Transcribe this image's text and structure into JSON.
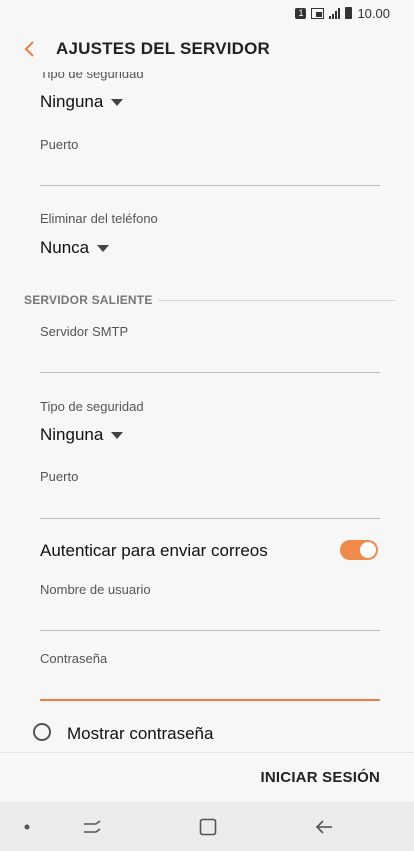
{
  "status_bar": {
    "sim": "1",
    "time": "10.00"
  },
  "header": {
    "title": "AJUSTES DEL SERVIDOR"
  },
  "incoming": {
    "security_type_label": "Tipo de seguridad",
    "security_type_value": "Ninguna",
    "port_label": "Puerto",
    "port_value": "",
    "delete_label": "Eliminar del teléfono",
    "delete_value": "Nunca"
  },
  "outgoing": {
    "section_title": "SERVIDOR SALIENTE",
    "smtp_label": "Servidor SMTP",
    "smtp_value": "",
    "security_type_label": "Tipo de seguridad",
    "security_type_value": "Ninguna",
    "port_label": "Puerto",
    "port_value": "",
    "auth_label": "Autenticar para enviar correos",
    "auth_enabled": true,
    "username_label": "Nombre de usuario",
    "username_value": "",
    "password_label": "Contraseña",
    "password_value": "",
    "show_password_label": "Mostrar contraseña",
    "show_password_checked": false
  },
  "actions": {
    "sign_in": "INICIAR SESIÓN"
  },
  "colors": {
    "accent": "#ee7d40",
    "toggle_on": "#f08a4b"
  },
  "nav_icons": [
    "dot-indicator-icon",
    "recent-apps-icon",
    "home-icon",
    "back-arrow-icon"
  ]
}
